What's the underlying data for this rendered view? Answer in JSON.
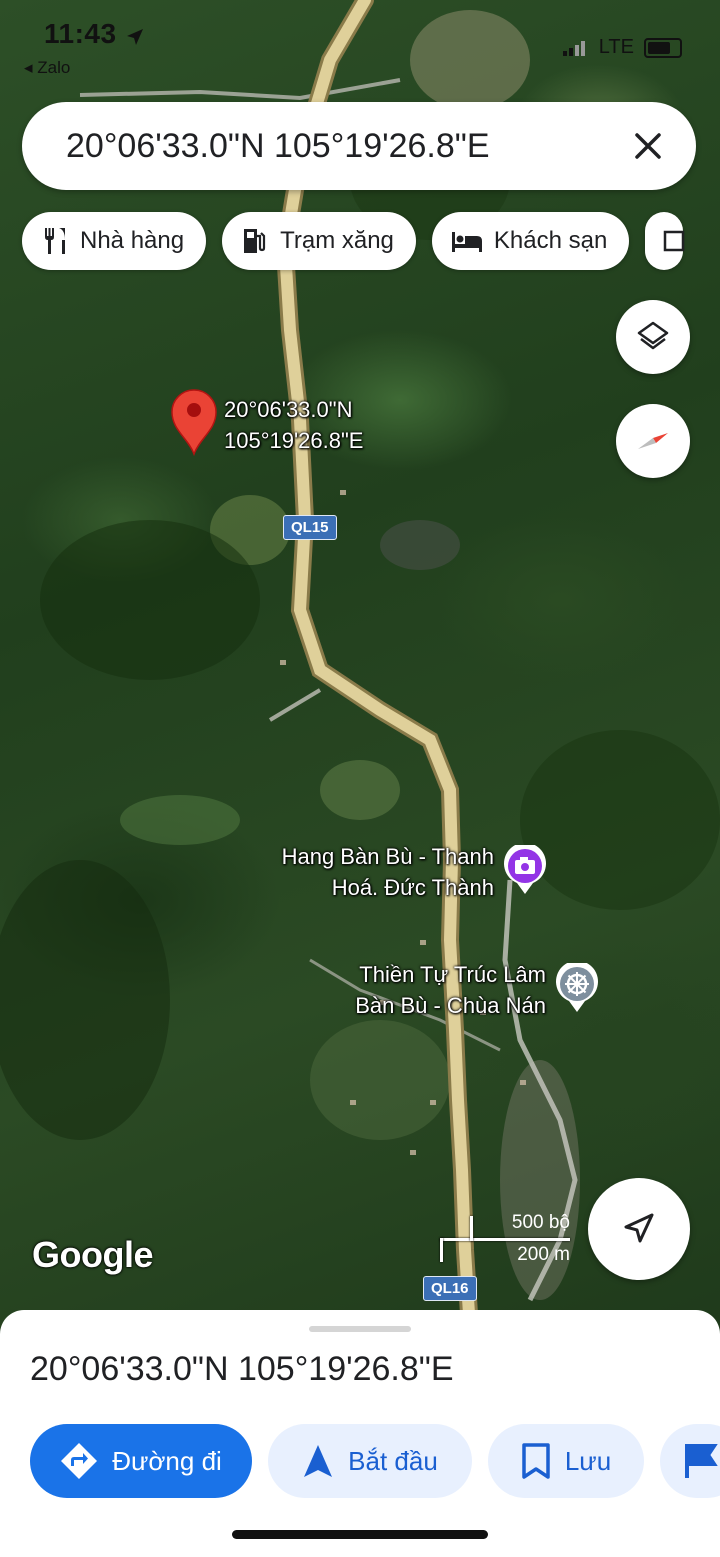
{
  "status": {
    "time": "11:43",
    "back_app": "◂ Zalo",
    "network": "LTE"
  },
  "search": {
    "query": "20°06'33.0\"N 105°19'26.8\"E"
  },
  "chips": [
    {
      "label": "Nhà hàng",
      "icon": "restaurant-icon"
    },
    {
      "label": "Trạm xăng",
      "icon": "gas-station-icon"
    },
    {
      "label": "Khách sạn",
      "icon": "hotel-icon"
    }
  ],
  "pin": {
    "line1": "20°06'33.0\"N",
    "line2": "105°19'26.8\"E"
  },
  "roads": {
    "ql15": "QL15",
    "ql16": "QL16"
  },
  "places": {
    "cave": {
      "line1": "Hang Bàn Bù - Thanh",
      "line2": "Hoá. Đức Thành",
      "icon": "camera-icon"
    },
    "temple": {
      "line1": "Thiền Tự Trúc Lâm",
      "line2": "Bàn Bù - Chùa Nán",
      "icon": "dharma-wheel-icon"
    }
  },
  "map": {
    "attribution": "Google",
    "scale_imperial": "500 bộ",
    "scale_metric": "200 m"
  },
  "sheet": {
    "title": "20°06'33.0\"N 105°19'26.8\"E",
    "actions": {
      "directions": "Đường đi",
      "start": "Bắt đầu",
      "save": "Lưu"
    }
  },
  "colors": {
    "accent": "#1a73e8",
    "pin": "#ea4335",
    "road": "#d9c98f"
  }
}
